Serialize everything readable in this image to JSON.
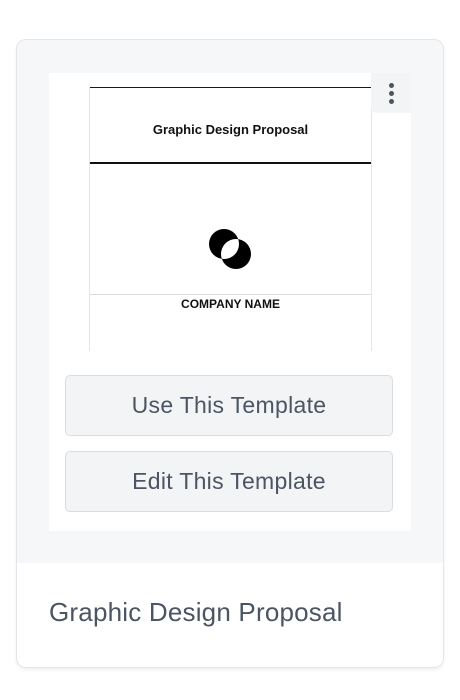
{
  "preview": {
    "doc_title": "Graphic Design Proposal",
    "company_name": "COMPANY NAME",
    "logo_icon": "overlapping-circles-logo"
  },
  "menu": {
    "icon": "kebab-menu-icon"
  },
  "actions": {
    "use_label": "Use This Template",
    "edit_label": "Edit This Template"
  },
  "card": {
    "title": "Graphic Design Proposal"
  },
  "colors": {
    "card_bg": "#f6f7f9",
    "button_bg": "#f3f4f6",
    "button_text": "#4b5563",
    "title_text": "#4b5563"
  }
}
